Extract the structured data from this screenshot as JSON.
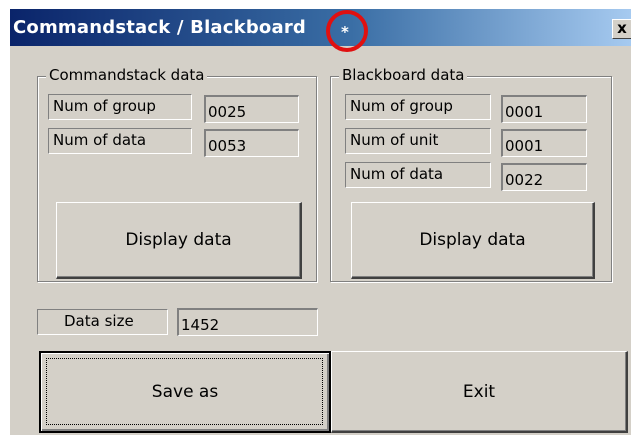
{
  "window": {
    "title": "Commandstack / Blackboard",
    "title_marker": "*",
    "close_label": "x"
  },
  "commandstack": {
    "legend": "Commandstack data",
    "fields": [
      {
        "label": "Num of group",
        "value": "0025"
      },
      {
        "label": "Num of data",
        "value": "0053"
      }
    ],
    "display_button": "Display data"
  },
  "blackboard": {
    "legend": "Blackboard data",
    "fields": [
      {
        "label": "Num of group",
        "value": "0001"
      },
      {
        "label": "Num of unit",
        "value": "0001"
      },
      {
        "label": "Num of data",
        "value": "0022"
      }
    ],
    "display_button": "Display data"
  },
  "data_size": {
    "label": "Data size",
    "value": "1452"
  },
  "buttons": {
    "save_as": "Save as",
    "exit": "Exit"
  },
  "colors": {
    "annotation_circle": "#e01010",
    "title_bar": "#0a246a",
    "face": "#d4d0c8"
  }
}
